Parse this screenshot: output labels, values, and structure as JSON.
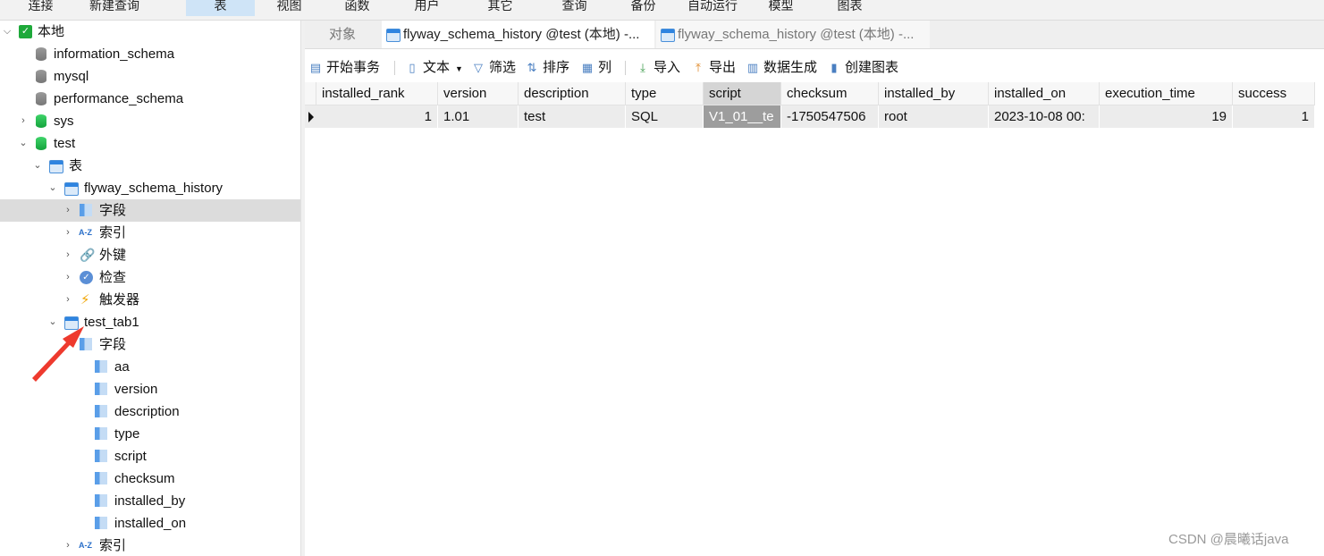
{
  "menu": [
    "连接",
    "新建查询",
    "表",
    "视图",
    "函数",
    "用户",
    "其它",
    "查询",
    "备份",
    "自动运行",
    "模型",
    "图表"
  ],
  "menu_active": "表",
  "tree": {
    "root": "本地",
    "databases": [
      "information_schema",
      "mysql",
      "performance_schema",
      "sys",
      "test"
    ],
    "tables_group": "表",
    "table1": "flyway_schema_history",
    "table1_children": [
      "字段",
      "索引",
      "外键",
      "检查",
      "触发器"
    ],
    "table2": "test_tab1",
    "fields_group": "字段",
    "fields": [
      "aa",
      "version",
      "description",
      "type",
      "script",
      "checksum",
      "installed_by",
      "installed_on"
    ],
    "index_group": "索引"
  },
  "tabs": {
    "objects": "对象",
    "tab1": "flyway_schema_history @test (本地) -...",
    "tab2": "flyway_schema_history @test (本地) -..."
  },
  "toolbar": {
    "begin_tx": "开始事务",
    "text": "文本",
    "filter": "筛选",
    "sort": "排序",
    "columns": "列",
    "import": "导入",
    "export": "导出",
    "datagen": "数据生成",
    "chart": "创建图表"
  },
  "grid": {
    "headers": [
      "installed_rank",
      "version",
      "description",
      "type",
      "script",
      "checksum",
      "installed_by",
      "installed_on",
      "execution_time",
      "success"
    ],
    "row": [
      "1",
      "1.01",
      "test",
      "SQL",
      "V1_01__te",
      "-1750547506",
      "root",
      "2023-10-08 00:",
      "19",
      "1"
    ]
  },
  "watermark": "CSDN @晨曦话java"
}
